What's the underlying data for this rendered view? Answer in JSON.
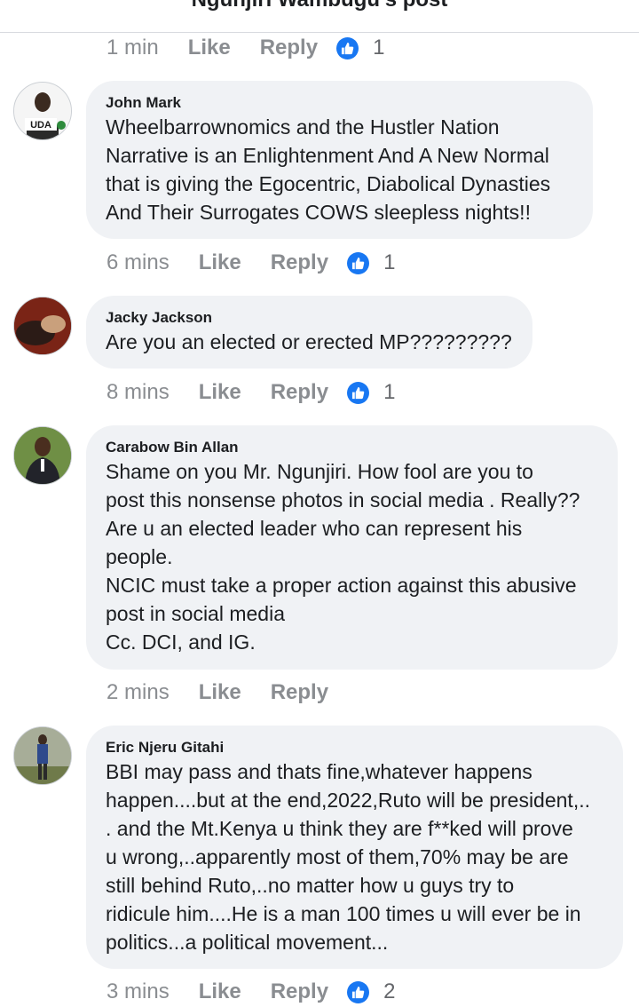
{
  "header": {
    "title": "Ngunjiri Wambugu's post"
  },
  "comments": [
    {
      "meta": {
        "time": "1 min",
        "like": "Like",
        "reply": "Reply",
        "reactions": "1"
      }
    },
    {
      "author": "John Mark",
      "avatar_badge": "UDA",
      "text": "Wheelbarrownomics and the Hustler Nation\nNarrative is an Enlightenment And A New Normal\nthat is giving the Egocentric, Diabolical Dynasties\nAnd Their Surrogates COWS sleepless nights!!",
      "meta": {
        "time": "6 mins",
        "like": "Like",
        "reply": "Reply",
        "reactions": "1"
      }
    },
    {
      "author": "Jacky Jackson",
      "text": "Are you an elected or erected MP?????????",
      "meta": {
        "time": "8 mins",
        "like": "Like",
        "reply": "Reply",
        "reactions": "1"
      }
    },
    {
      "author": "Carabow Bin Allan",
      "text": "Shame on you Mr. Ngunjiri.  How  fool are you to\npost this nonsense photos in social media . Really??\nAre u an elected leader who can represent his\npeople.\nNCIC must take a proper action against this abusive\npost in social media\nCc. DCI, and IG.",
      "meta": {
        "time": "2 mins",
        "like": "Like",
        "reply": "Reply"
      }
    },
    {
      "author": "Eric Njeru Gitahi",
      "text": "BBI may pass and thats fine,whatever happens\nhappen....but at the end,2022,Ruto will be president,..\n. and the Mt.Kenya u think they are f**ked will prove\nu wrong,..apparently most of them,70% may be are\nstill behind Ruto,..no matter how u guys try to\nridicule him....He is a man 100 times u will ever be in\npolitics...a political movement...",
      "meta": {
        "time": "3 mins",
        "like": "Like",
        "reply": "Reply",
        "reactions": "2"
      }
    }
  ],
  "colors": {
    "like_blue": "#1877f2",
    "bubble": "#f0f2f5",
    "meta_gray": "#8a8d91"
  }
}
